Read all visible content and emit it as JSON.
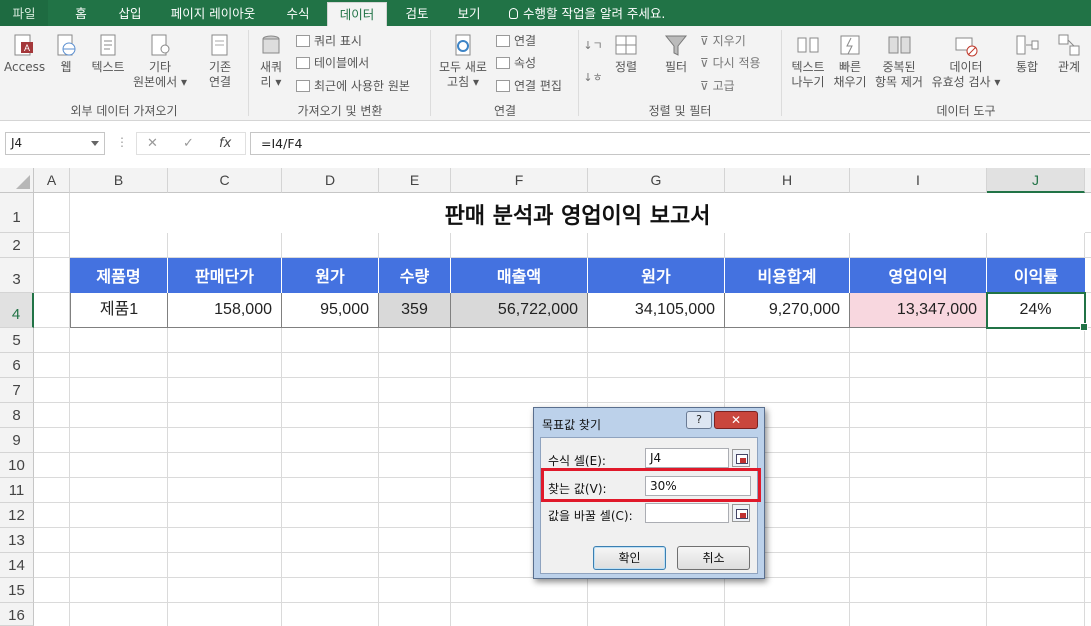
{
  "ribbon_tabs": [
    {
      "label": "파일"
    },
    {
      "label": "홈"
    },
    {
      "label": "삽입"
    },
    {
      "label": "페이지 레이아웃"
    },
    {
      "label": "수식"
    },
    {
      "label": "데이터"
    },
    {
      "label": "검토"
    },
    {
      "label": "보기"
    }
  ],
  "active_tab": "데이터",
  "tell_me": "수행할 작업을 알려 주세요.",
  "ribbon": {
    "get_external": {
      "access": "Access",
      "web": "웹",
      "text": "텍스트",
      "other_1": "기타",
      "other_2": "원본에서",
      "group": "외부 데이터 가져오기"
    },
    "existing_1": "기존",
    "existing_2": "연결",
    "transform": {
      "new_query_1": "새쿼",
      "new_query_2": "리",
      "show_queries": "쿼리 표시",
      "from_table": "테이블에서",
      "recent_sources": "최근에 사용한 원본",
      "group": "가져오기 및 변환"
    },
    "connections": {
      "refresh_1": "모두 새로",
      "refresh_2": "고침",
      "connections": "연결",
      "properties": "속성",
      "edit_links": "연결 편집",
      "group": "연결"
    },
    "sort_filter": {
      "sort": "정렬",
      "filter": "필터",
      "clear": "지우기",
      "reapply": "다시 적용",
      "advanced": "고급",
      "group": "정렬 및 필터"
    },
    "data_tools": {
      "text_to_cols_1": "텍스트",
      "text_to_cols_2": "나누기",
      "flash_fill_1": "빠른",
      "flash_fill_2": "채우기",
      "remove_dup_1": "중복된",
      "remove_dup_2": "항목 제거",
      "validation_1": "데이터",
      "validation_2": "유효성 검사",
      "consolidate": "통합",
      "relationships": "관계",
      "group": "데이터 도구"
    }
  },
  "formula_bar": {
    "name_box": "J4",
    "fx": "fx",
    "formula": "=I4/F4"
  },
  "columns": [
    "A",
    "B",
    "C",
    "D",
    "E",
    "F",
    "G",
    "H",
    "I",
    "J"
  ],
  "rows": [
    "1",
    "2",
    "3",
    "4",
    "5",
    "6",
    "7",
    "8",
    "9",
    "10",
    "11",
    "12",
    "13",
    "14",
    "15",
    "16"
  ],
  "sheet": {
    "title": "판매 분석과 영업이익 보고서",
    "headers": [
      "제품명",
      "판매단가",
      "원가",
      "수량",
      "매출액",
      "원가",
      "비용합계",
      "영업이익",
      "이익률"
    ],
    "row4": [
      "제품1",
      "158,000",
      "95,000",
      "359",
      "56,722,000",
      "34,105,000",
      "9,270,000",
      "13,347,000",
      "24%"
    ]
  },
  "dialog": {
    "title": "목표값 찾기",
    "help": "?",
    "close": "✕",
    "set_cell_label": "수식 셀(E):",
    "set_cell_value": "J4",
    "to_value_label": "찾는 값(V):",
    "to_value_value": "30%",
    "changing_label": "값을 바꿀 셀(C):",
    "changing_value": "",
    "ok": "확인",
    "cancel": "취소"
  },
  "colors": {
    "excel_green": "#217346",
    "header_blue": "#4472e0",
    "pink_fill": "#f8d7df",
    "gray_fill": "#d9d9d9",
    "highlight_red": "#e0192a"
  }
}
